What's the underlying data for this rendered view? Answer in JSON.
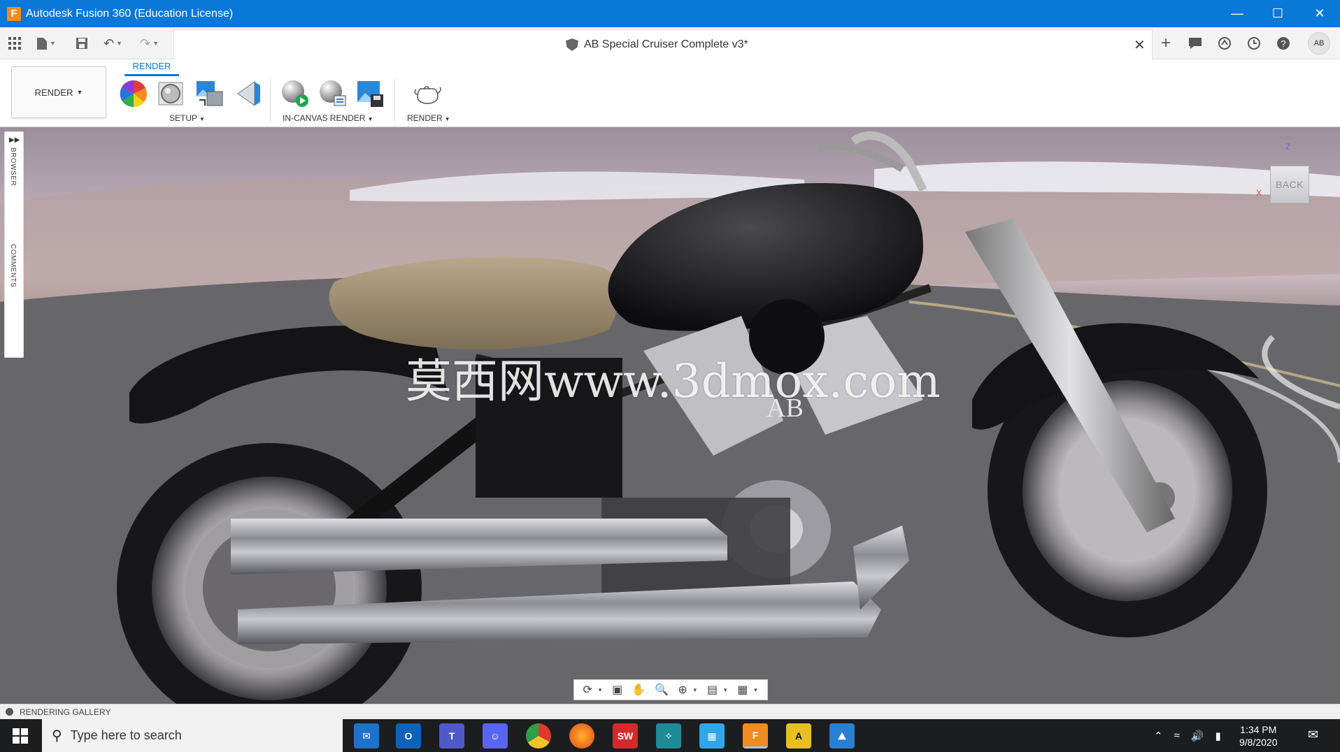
{
  "window": {
    "title": "Autodesk Fusion 360 (Education License)",
    "app_icon_letter": "F"
  },
  "document": {
    "title": "AB Special Cruiser Complete v3*"
  },
  "toolbar": {
    "workspace_label": "RENDER",
    "active_tab": "RENDER",
    "groups": [
      {
        "label": "SETUP"
      },
      {
        "label": "IN-CANVAS RENDER"
      },
      {
        "label": "RENDER"
      }
    ]
  },
  "side_panel": {
    "browser_label": "BROWSER",
    "comments_label": "COMMENTS"
  },
  "viewcube": {
    "face": "BACK",
    "z_axis": "Z",
    "x_axis": "X"
  },
  "canvas": {
    "watermark": "莫西网www.3dmox.com",
    "logo_text": "AB"
  },
  "bottom": {
    "gallery_label": "RENDERING GALLERY"
  },
  "taskbar": {
    "search_placeholder": "Type here to search",
    "time": "1:34 PM",
    "date": "9/8/2020",
    "apps": [
      {
        "name": "mail",
        "color": "#1e73c8"
      },
      {
        "name": "outlook",
        "color": "#0f62b8"
      },
      {
        "name": "teams",
        "color": "#5059c9"
      },
      {
        "name": "discord",
        "color": "#5865f2"
      },
      {
        "name": "chrome",
        "color": "#e2b02a"
      },
      {
        "name": "firefox",
        "color": "#e66a1b"
      },
      {
        "name": "solidworks",
        "color": "#d42a2a"
      },
      {
        "name": "maya",
        "color": "#1f8a96"
      },
      {
        "name": "explorer",
        "color": "#2fa6e6"
      },
      {
        "name": "fusion360",
        "color": "#f08b20"
      },
      {
        "name": "autocad",
        "color": "#e8c021"
      },
      {
        "name": "photos",
        "color": "#2a7fd0"
      }
    ],
    "solidworks_label": "SW",
    "fusion_label": "F",
    "autocad_label": "A"
  }
}
